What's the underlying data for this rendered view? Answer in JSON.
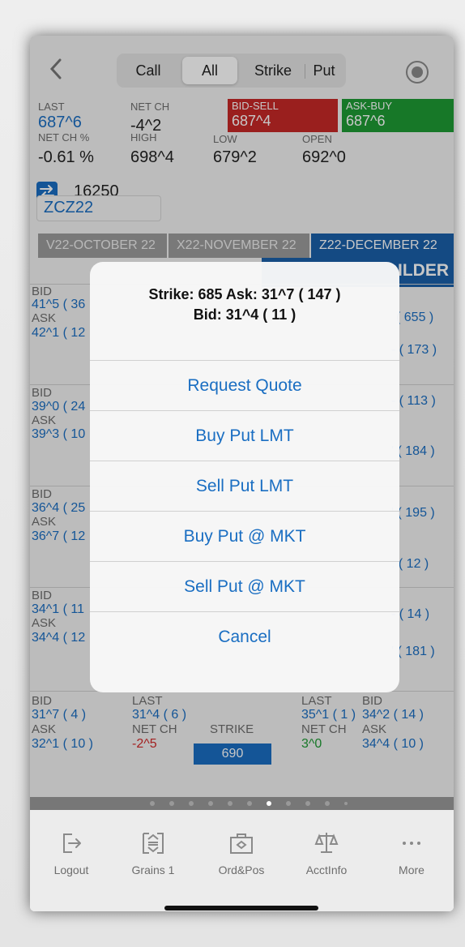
{
  "nav": {
    "segments": [
      "Call",
      "All",
      "Strike",
      "Put"
    ],
    "active_segment": "All"
  },
  "quote": {
    "last_label": "LAST",
    "last_value": "687^6",
    "net_ch_label": "NET CH",
    "net_ch_value": "-4^2",
    "bid_sell_label": "BID-SELL",
    "bid_sell_value": "687^4",
    "ask_buy_label": "ASK-BUY",
    "ask_buy_value": "687^6",
    "net_ch_pct_label": "NET CH %",
    "net_ch_pct_value": "-0.61 %",
    "high_label": "HIGH",
    "high_value": "698^4",
    "low_label": "LOW",
    "low_value": "679^2",
    "open_label": "OPEN",
    "open_value": "692^0",
    "volume": "16250",
    "symbol": "ZCZ22"
  },
  "months": [
    {
      "label": "V22-OCTOBER 22"
    },
    {
      "label": "X22-NOVEMBER 22"
    },
    {
      "label": "Z22-DECEMBER 22"
    }
  ],
  "builder_label": "ILDER",
  "grid": {
    "rows": [
      {
        "bid_label": "BID",
        "bid": "41^5 ( 36",
        "ask_label": "ASK",
        "ask": "42^1 ( 12",
        "r_bid": "( 655 )",
        "r_ask": "- ( 173 )"
      },
      {
        "bid_label": "BID",
        "bid": "39^0 ( 24",
        "ask_label": "ASK",
        "ask": "39^3 ( 10",
        "r_bid": "- ( 113 )",
        "r_ask": "' ( 184 )"
      },
      {
        "bid_label": "BID",
        "bid": "36^4 ( 25",
        "ask_label": "ASK",
        "ask": "36^7 ( 12",
        "r_bid": "' ( 195 )",
        "r_ask": ": ( 12 )"
      },
      {
        "bid_label": "BID",
        "bid": "34^1 ( 11",
        "ask_label": "ASK",
        "ask": "34^4 ( 12",
        "r_bid": "- ( 14 )",
        "r_ask": "' ( 181 )"
      }
    ],
    "last_row": {
      "bid_label": "BID",
      "bid": "31^7 ( 4 )",
      "ask_label": "ASK",
      "ask": "32^1 ( 10 )",
      "last_label": "LAST",
      "last": "31^4 ( 6 )",
      "net_ch_label": "NET CH",
      "net_ch": "-2^5",
      "strike_label": "STRIKE",
      "strike": "690",
      "last2_label": "LAST",
      "last2": "35^1 ( 1 )",
      "net_ch2_label": "NET CH",
      "net_ch2": "3^0",
      "bid2_label": "BID",
      "bid2": "34^2 ( 14 )",
      "ask2_label": "ASK",
      "ask2": "34^4 ( 10 )"
    }
  },
  "alert": {
    "title_line1": "Strike: 685 Ask: 31^7 ( 147 )",
    "title_line2": "Bid: 31^4 ( 11 )",
    "buttons": [
      "Request Quote",
      "Buy Put LMT",
      "Sell Put LMT",
      "Buy Put @ MKT",
      "Sell Put @ MKT",
      "Cancel"
    ]
  },
  "pager": {
    "count": 11,
    "active_index": 6
  },
  "tabbar": {
    "items": [
      {
        "label": "Logout",
        "icon": "logout-icon"
      },
      {
        "label": "Grains 1",
        "icon": "grains-icon"
      },
      {
        "label": "Ord&Pos",
        "icon": "briefcase-icon"
      },
      {
        "label": "AcctInfo",
        "icon": "scale-icon"
      },
      {
        "label": "More",
        "icon": "more-icon"
      }
    ]
  },
  "colors": {
    "accent": "#1a6ec2",
    "sell": "#c62827",
    "buy": "#1e9a34"
  }
}
